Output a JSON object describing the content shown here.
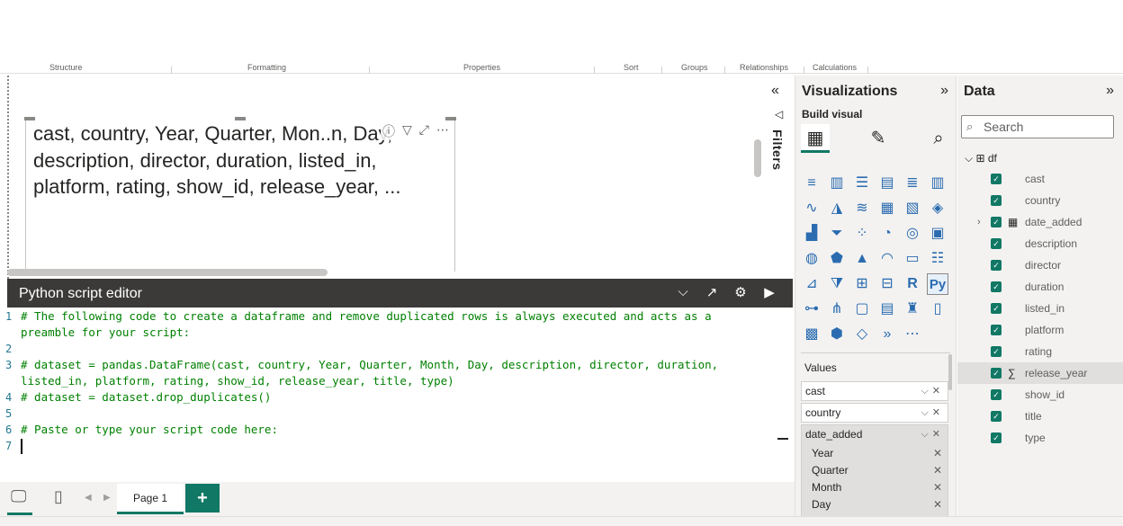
{
  "ribbon": {
    "groups": [
      "Structure",
      "Formatting",
      "Properties",
      "Sort",
      "Groups",
      "Relationships",
      "Calculations"
    ]
  },
  "card": {
    "text": "cast, country, Year, Quarter, Mon..n, Day, description, director, duration, listed_in, platform, rating, show_id, release_year, ..."
  },
  "editor": {
    "title": "Python script editor",
    "lines": [
      {
        "n": "1",
        "text": "# The following code to create a dataframe and remove duplicated rows is always executed and acts as a"
      },
      {
        "n": "",
        "text": "preamble for your script:"
      },
      {
        "n": "2",
        "text": ""
      },
      {
        "n": "3",
        "text": "# dataset = pandas.DataFrame(cast, country, Year, Quarter, Month, Day, description, director, duration,"
      },
      {
        "n": "",
        "text": "listed_in, platform, rating, show_id, release_year, title, type)"
      },
      {
        "n": "4",
        "text": "# dataset = dataset.drop_duplicates()"
      },
      {
        "n": "5",
        "text": ""
      },
      {
        "n": "6",
        "text": "# Paste or type your script code here:"
      },
      {
        "n": "7",
        "text": ""
      }
    ]
  },
  "pagebar": {
    "page_label": "Page 1",
    "add_label": "+"
  },
  "filters": {
    "label": "Filters"
  },
  "viz": {
    "title": "Visualizations",
    "build_label": "Build visual",
    "values_label": "Values",
    "wells": [
      "cast",
      "country"
    ],
    "group": {
      "title": "date_added",
      "children": [
        "Year",
        "Quarter",
        "Month",
        "Day"
      ]
    }
  },
  "data": {
    "title": "Data",
    "search_placeholder": "Search",
    "table": "df",
    "fields": [
      "cast",
      "country",
      "date_added",
      "description",
      "director",
      "duration",
      "listed_in",
      "platform",
      "rating",
      "release_year",
      "show_id",
      "title",
      "type"
    ]
  },
  "colors": {
    "accent": "#117865",
    "header": "#3b3a39",
    "pane": "#f3f2f1",
    "code_comment": "#008000"
  }
}
